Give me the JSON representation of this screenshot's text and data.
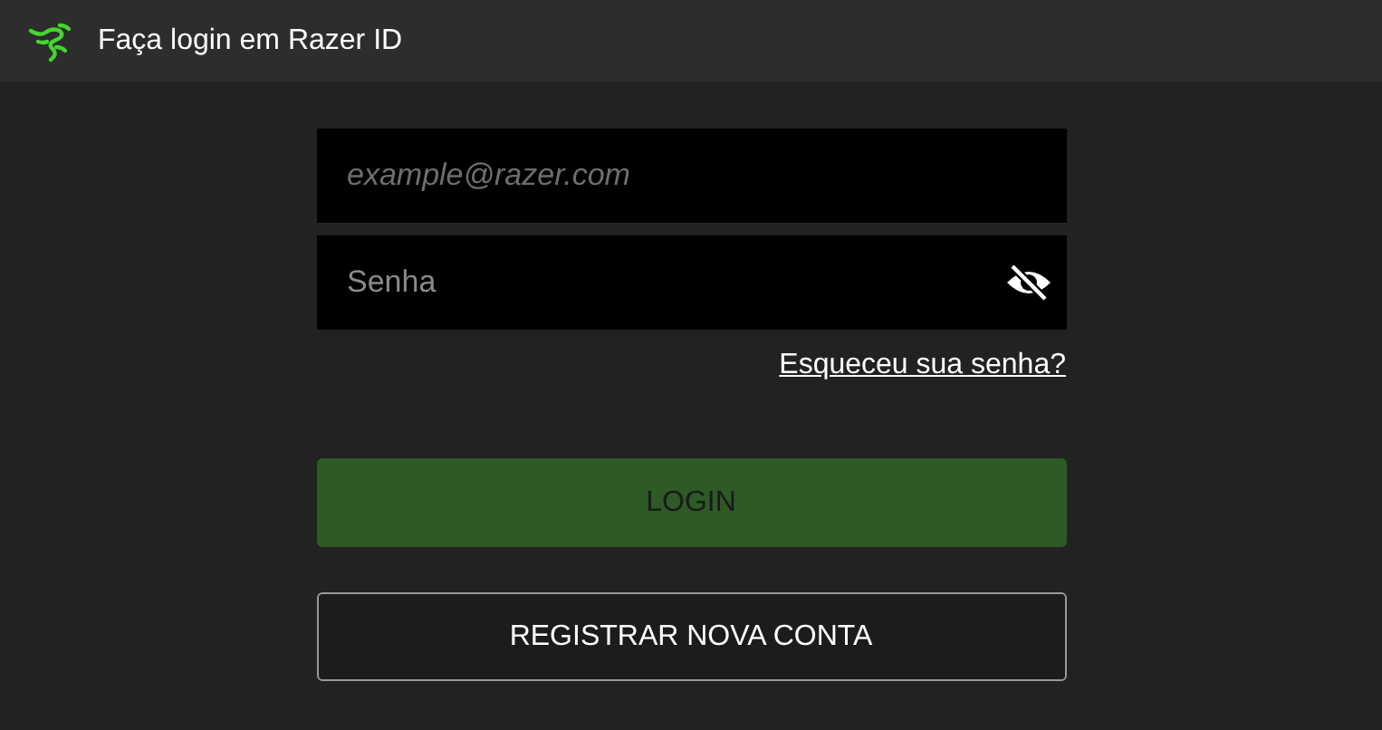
{
  "window": {
    "title": "Faça login em Razer ID"
  },
  "fields": [
    {
      "kind": "email",
      "placeholder": "example@razer.com"
    },
    {
      "kind": "password",
      "placeholder": "Senha"
    }
  ],
  "forgot_link": "Esqueceu sua senha?",
  "buttons": [
    {
      "kind": "primary",
      "label": "LOGIN",
      "disabled": true
    },
    {
      "kind": "outline",
      "label": "REGISTRAR NOVA CONTA",
      "disabled": false
    }
  ]
}
